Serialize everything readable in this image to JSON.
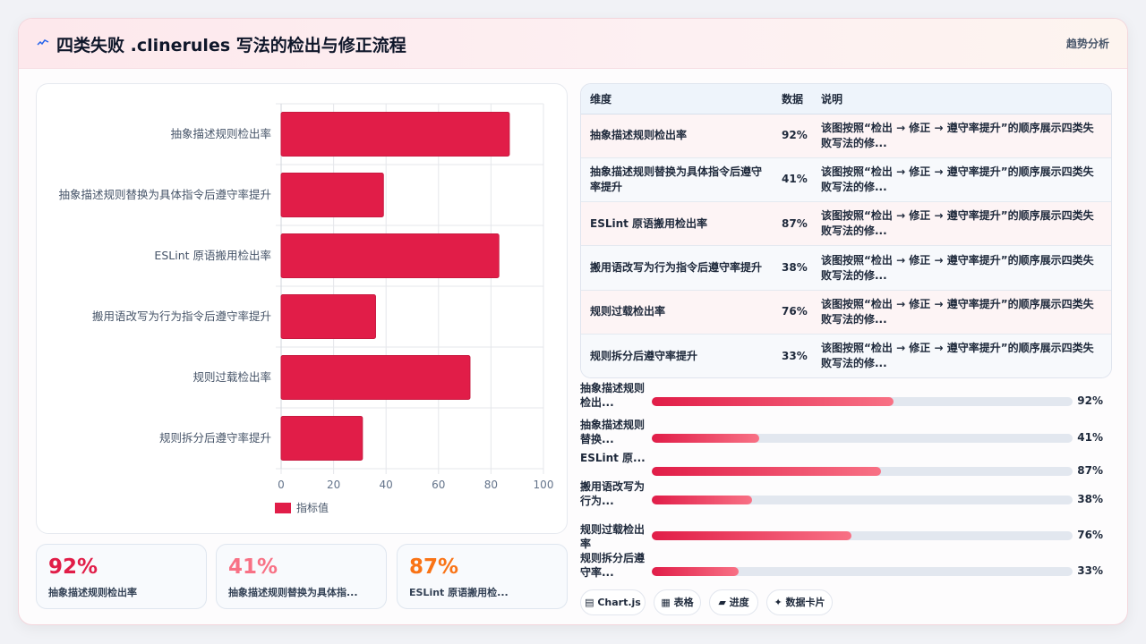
{
  "header": {
    "icon": "sparkline-icon",
    "title": "四类失败 .clinerules 写法的检出与修正流程",
    "tag": "趋势分析"
  },
  "colors": {
    "bar": "#e11d48",
    "kpi1": "#e11d48",
    "kpi2": "#f87185",
    "kpi3": "#f97316"
  },
  "chart_data": {
    "type": "bar",
    "orientation": "horizontal",
    "categories": [
      "抽象描述规则检出率",
      "抽象描述规则替换为具体指令后遵守率提升",
      "ESLint 原语搬用检出率",
      "搬用语改写为行为指令后遵守率提升",
      "规则过载检出率",
      "规则拆分后遵守率提升"
    ],
    "series": [
      {
        "name": "指标值",
        "values": [
          87,
          39,
          83,
          36,
          72,
          31
        ]
      }
    ],
    "xlim": [
      0,
      100
    ],
    "xticks": [
      "0",
      "20",
      "40",
      "60",
      "80",
      "100"
    ],
    "grid": true,
    "legend": "bottom-left"
  },
  "table": {
    "headers": [
      "维度",
      "数据",
      "说明"
    ],
    "rows": [
      {
        "dim": "抽象描述规则检出率",
        "val": "92%",
        "desc": "该图按照“检出 → 修正 → 遵守率提升”的顺序展示四类失败写法的修..."
      },
      {
        "dim": "抽象描述规则替换为具体指令后遵守率提升",
        "val": "41%",
        "desc": "该图按照“检出 → 修正 → 遵守率提升”的顺序展示四类失败写法的修..."
      },
      {
        "dim": "ESLint 原语搬用检出率",
        "val": "87%",
        "desc": "该图按照“检出 → 修正 → 遵守率提升”的顺序展示四类失败写法的修..."
      },
      {
        "dim": "搬用语改写为行为指令后遵守率提升",
        "val": "38%",
        "desc": "该图按照“检出 → 修正 → 遵守率提升”的顺序展示四类失败写法的修..."
      },
      {
        "dim": "规则过载检出率",
        "val": "76%",
        "desc": "该图按照“检出 → 修正 → 遵守率提升”的顺序展示四类失败写法的修..."
      },
      {
        "dim": "规则拆分后遵守率提升",
        "val": "33%",
        "desc": "该图按照“检出 → 修正 → 遵守率提升”的顺序展示四类失败写法的修..."
      }
    ]
  },
  "progress": [
    {
      "label": "抽象描述规则检出...",
      "value": "92%",
      "fill": 0.575
    },
    {
      "label": "抽象描述规则替换...",
      "value": "41%",
      "fill": 0.255
    },
    {
      "label": "ESLint 原...",
      "value": "87%",
      "fill": 0.544
    },
    {
      "label": "搬用语改写为行为...",
      "value": "38%",
      "fill": 0.238
    },
    {
      "label": "规则过载检出率",
      "value": "76%",
      "fill": 0.475
    },
    {
      "label": "规则拆分后遵守率...",
      "value": "33%",
      "fill": 0.206
    }
  ],
  "kpis": [
    {
      "value": "92%",
      "label": "抽象描述规则检出率"
    },
    {
      "value": "41%",
      "label": "抽象描述规则替换为具体指..."
    },
    {
      "value": "87%",
      "label": "ESLint 原语搬用检..."
    }
  ],
  "chips": [
    {
      "icon": "chart-icon",
      "label": "▤ Chart.js"
    },
    {
      "icon": "table-icon",
      "label": "▦ 表格"
    },
    {
      "icon": "progress-icon",
      "label": "▰ 进度"
    },
    {
      "icon": "sparkle-icon",
      "label": "✦ 数据卡片"
    }
  ]
}
